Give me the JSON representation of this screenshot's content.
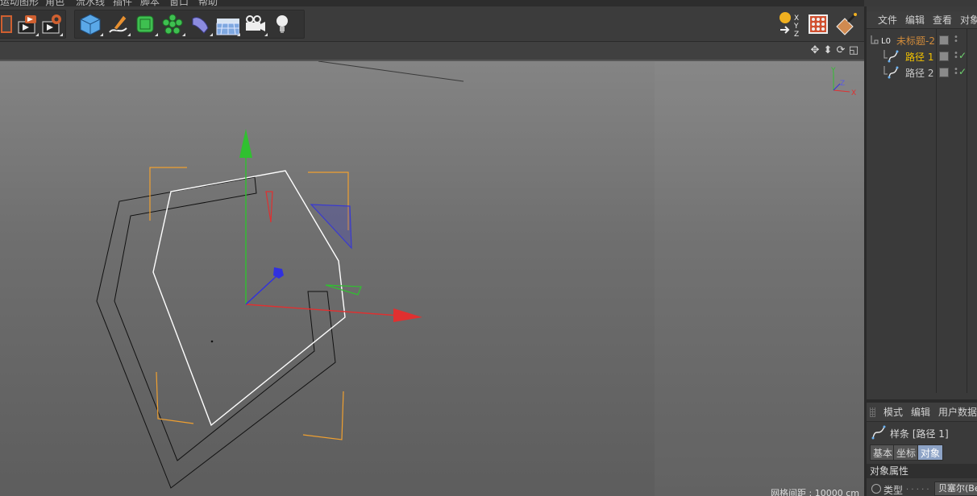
{
  "menubar": {
    "items": [
      "运动图形",
      "角色",
      "流水线",
      "插件",
      "脚本",
      "窗口",
      "帮助"
    ]
  },
  "toolbar": {
    "group1": [
      {
        "icon": "render-active-view-icon"
      },
      {
        "icon": "render-to-picture-viewer-icon"
      },
      {
        "icon": "render-settings-icon"
      }
    ],
    "group2": [
      {
        "icon": "cube-primitive-icon"
      },
      {
        "icon": "pen-spline-icon"
      },
      {
        "icon": "subdivision-surface-icon"
      },
      {
        "icon": "cloner-icon"
      },
      {
        "icon": "deformer-bend-icon"
      },
      {
        "icon": "floor-environment-icon"
      },
      {
        "icon": "camera-icon"
      },
      {
        "icon": "light-bulb-icon"
      }
    ],
    "right_icons": [
      {
        "icon": "world-axis-icon"
      },
      {
        "icon": "texture-mode-icon"
      },
      {
        "icon": "paint-mode-icon"
      }
    ]
  },
  "viewport": {
    "nav_icons": [
      "move-view-icon",
      "zoom-view-icon",
      "rotate-view-icon",
      "maximize-view-icon"
    ],
    "status": "网格间距 : 10000 cm",
    "axis_labels": {
      "y": "Y",
      "z": "Z",
      "x": "X"
    },
    "colors": {
      "x_axis": "#e03030",
      "y_axis": "#30c030",
      "z_axis": "#3030e0",
      "bbox": "#f0a030",
      "spline_selected": "#ffffff",
      "spline": "#111111"
    }
  },
  "object_manager": {
    "menu": [
      "文件",
      "编辑",
      "查看",
      "对象"
    ],
    "objects": [
      {
        "name": "未标题-2",
        "color": "#d18b3a",
        "indent": 0
      },
      {
        "name": "路径 1",
        "color": "#f2c200",
        "indent": 1
      },
      {
        "name": "路径 2",
        "color": "#c8c8c8",
        "indent": 1
      }
    ]
  },
  "attribute_manager": {
    "menu": [
      "模式",
      "编辑",
      "用户数据"
    ],
    "title": "样条 [路径 1]",
    "tabs": [
      "基本",
      "坐标",
      "对象"
    ],
    "active_tab": "对象",
    "section": "对象属性",
    "type_label": "类型",
    "type_dots": ". . . . .",
    "type_value": "贝塞尔(Bezier)"
  }
}
